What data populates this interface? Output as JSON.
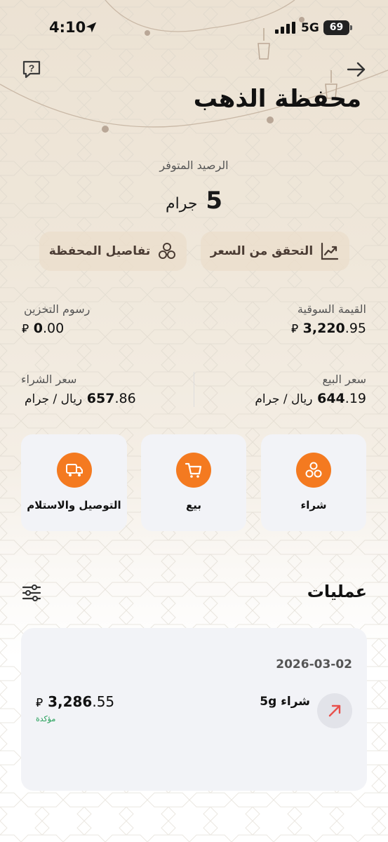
{
  "status_bar": {
    "time": "4:10",
    "network": "5G",
    "battery": "69"
  },
  "header": {
    "title": "محفظة الذهب",
    "help_icon": "help-chat-icon",
    "back_icon": "arrow-right-icon"
  },
  "balance": {
    "label": "الرصيد المتوفر",
    "value": "5",
    "unit": "جرام"
  },
  "buttons": {
    "check_price": "التحقق من السعر",
    "wallet_details": "تفاصيل المحفظة"
  },
  "stats": {
    "market_value_label": "القيمة السوقية",
    "market_value_int": "3,220",
    "market_value_dec": ".95",
    "storage_fees_label": "رسوم التخزين",
    "storage_fees_int": "0",
    "storage_fees_dec": ".00",
    "currency_symbol": "⃁",
    "sell_price_label": "سعر البيع",
    "sell_price_int": "644",
    "sell_price_dec": ".19",
    "buy_price_label": "سعر الشراء",
    "buy_price_int": "657",
    "buy_price_dec": ".86",
    "price_unit": "ريال / جرام"
  },
  "actions": {
    "buy": "شراء",
    "sell": "بيع",
    "delivery": "التوصيل والاستلام"
  },
  "operations": {
    "title": "عمليات",
    "transactions": [
      {
        "date": "2026-03-02",
        "title": "شراء 5g",
        "amount_int": "3,286",
        "amount_dec": ".55",
        "status": "مؤكدة"
      }
    ]
  },
  "colors": {
    "accent": "#f47a20",
    "success": "#25a05a",
    "card": "#f2f3f7"
  }
}
